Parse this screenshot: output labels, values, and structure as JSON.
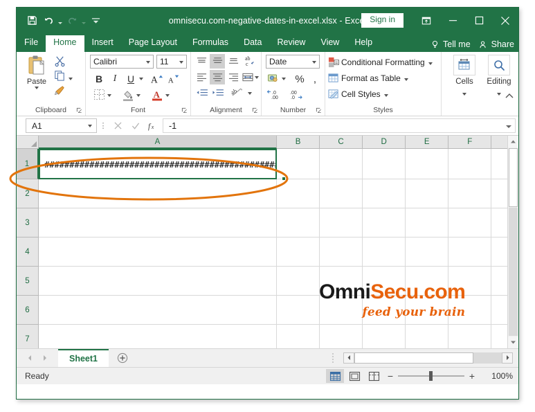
{
  "window": {
    "title": "omnisecu.com-negative-dates-in-excel.xlsx  -  Excel",
    "signin_label": "Sign in",
    "ribbon_display_icon": "ribbon-display-options-icon",
    "minimize_icon": "minimize-icon",
    "maximize_icon": "maximize-icon",
    "close_icon": "close-icon"
  },
  "qat": {
    "save_icon": "save-icon",
    "undo_icon": "undo-icon",
    "redo_icon": "redo-icon",
    "customize_icon": "customize-quick-access-toolbar-icon"
  },
  "tabs": [
    {
      "label": "File",
      "active": false
    },
    {
      "label": "Home",
      "active": true
    },
    {
      "label": "Insert",
      "active": false
    },
    {
      "label": "Page Layout",
      "active": false
    },
    {
      "label": "Formulas",
      "active": false
    },
    {
      "label": "Data",
      "active": false
    },
    {
      "label": "Review",
      "active": false
    },
    {
      "label": "View",
      "active": false
    },
    {
      "label": "Help",
      "active": false
    }
  ],
  "tab_extras": {
    "tellme_label": "Tell me",
    "tellme_icon": "lightbulb-icon",
    "share_label": "Share",
    "share_icon": "share-person-icon"
  },
  "ribbon": {
    "groups": [
      {
        "label": "Clipboard"
      },
      {
        "label": "Font"
      },
      {
        "label": "Alignment"
      },
      {
        "label": "Number"
      },
      {
        "label": "Styles"
      },
      {
        "label": ""
      }
    ],
    "clipboard": {
      "paste_label": "Paste",
      "paste_icon": "paste-icon",
      "cut_icon": "scissors-cut-icon",
      "copy_icon": "copy-icon",
      "format_painter_icon": "format-painter-icon"
    },
    "font": {
      "font_name": "Calibri",
      "font_size": "11",
      "bold_label": "B",
      "italic_label": "I",
      "underline_label": "U",
      "grow_font_label": "A",
      "shrink_font_label": "A",
      "borders_icon": "borders-icon",
      "fill_color_icon": "fill-color-icon",
      "font_color_icon": "font-color-icon"
    },
    "alignment": {
      "top_align_icon": "align-top-icon",
      "middle_align_icon": "align-middle-icon",
      "bottom_align_icon": "align-bottom-icon",
      "orientation_icon": "text-orientation-icon",
      "align_left_icon": "align-left-icon",
      "align_center_icon": "align-center-icon",
      "align_right_icon": "align-right-icon",
      "merge_cells_icon": "merge-and-center-icon",
      "decrease_indent_icon": "decrease-indent-icon",
      "increase_indent_icon": "increase-indent-icon",
      "wrap_text_icon": "wrap-text-icon"
    },
    "number": {
      "format": "Date",
      "accounting_icon": "accounting-number-format-icon",
      "percent_label": "%",
      "comma_label": ",",
      "increase_decimal_icon": "increase-decimal-icon",
      "decrease_decimal_icon": "decrease-decimal-icon"
    },
    "styles": {
      "conditional_formatting": "Conditional Formatting",
      "format_as_table": "Format as Table",
      "cell_styles": "Cell Styles",
      "conditional_formatting_icon": "conditional-formatting-icon",
      "format_as_table_icon": "format-as-table-icon",
      "cell_styles_icon": "cell-styles-icon"
    },
    "cells": {
      "label": "Cells",
      "icon": "cells-insert-icon"
    },
    "editing": {
      "label": "Editing",
      "icon": "find-select-magnifier-icon"
    },
    "collapse_icon": "collapse-ribbon-caret-icon"
  },
  "formula_bar": {
    "name_box": "A1",
    "cancel_icon": "cancel-x-icon",
    "enter_icon": "enter-check-icon",
    "function_icon": "insert-function-fx-icon",
    "formula_value": "-1",
    "expand_icon": "expand-formula-bar-icon"
  },
  "grid": {
    "columns": [
      "A",
      "B",
      "C",
      "D",
      "E",
      "F"
    ],
    "active_column": "A",
    "rows": [
      "1",
      "2",
      "3",
      "4",
      "5",
      "6",
      "7"
    ],
    "active_row": "1",
    "cell_a1_display": "##################################################################",
    "select_all_icon": "select-all-corner-icon"
  },
  "watermark": {
    "brand_first": "Omni",
    "brand_second": "Secu.com",
    "tagline": "feed your brain",
    "brand_color": "#e8620c",
    "dark_color": "#1a1a1a"
  },
  "annotation": {
    "shape": "ellipse-highlight",
    "color": "#e2740c"
  },
  "sheet_bar": {
    "prev_icon": "previous-sheet-arrow-icon",
    "next_icon": "next-sheet-arrow-icon",
    "tabs": [
      {
        "label": "Sheet1",
        "active": true
      }
    ],
    "add_sheet_icon": "add-sheet-plus-icon",
    "scroll_left_icon": "scroll-left-arrow-icon",
    "scroll_right_icon": "scroll-right-arrow-icon"
  },
  "status_bar": {
    "status": "Ready",
    "normal_view_icon": "normal-view-icon",
    "page_layout_icon": "page-layout-view-icon",
    "page_break_icon": "page-break-preview-icon",
    "zoom_out_label": "−",
    "zoom_in_label": "+",
    "zoom_level": "100%"
  },
  "colors": {
    "excel_green": "#217346",
    "accent_orange": "#e8620c",
    "selection_green": "#217346"
  }
}
